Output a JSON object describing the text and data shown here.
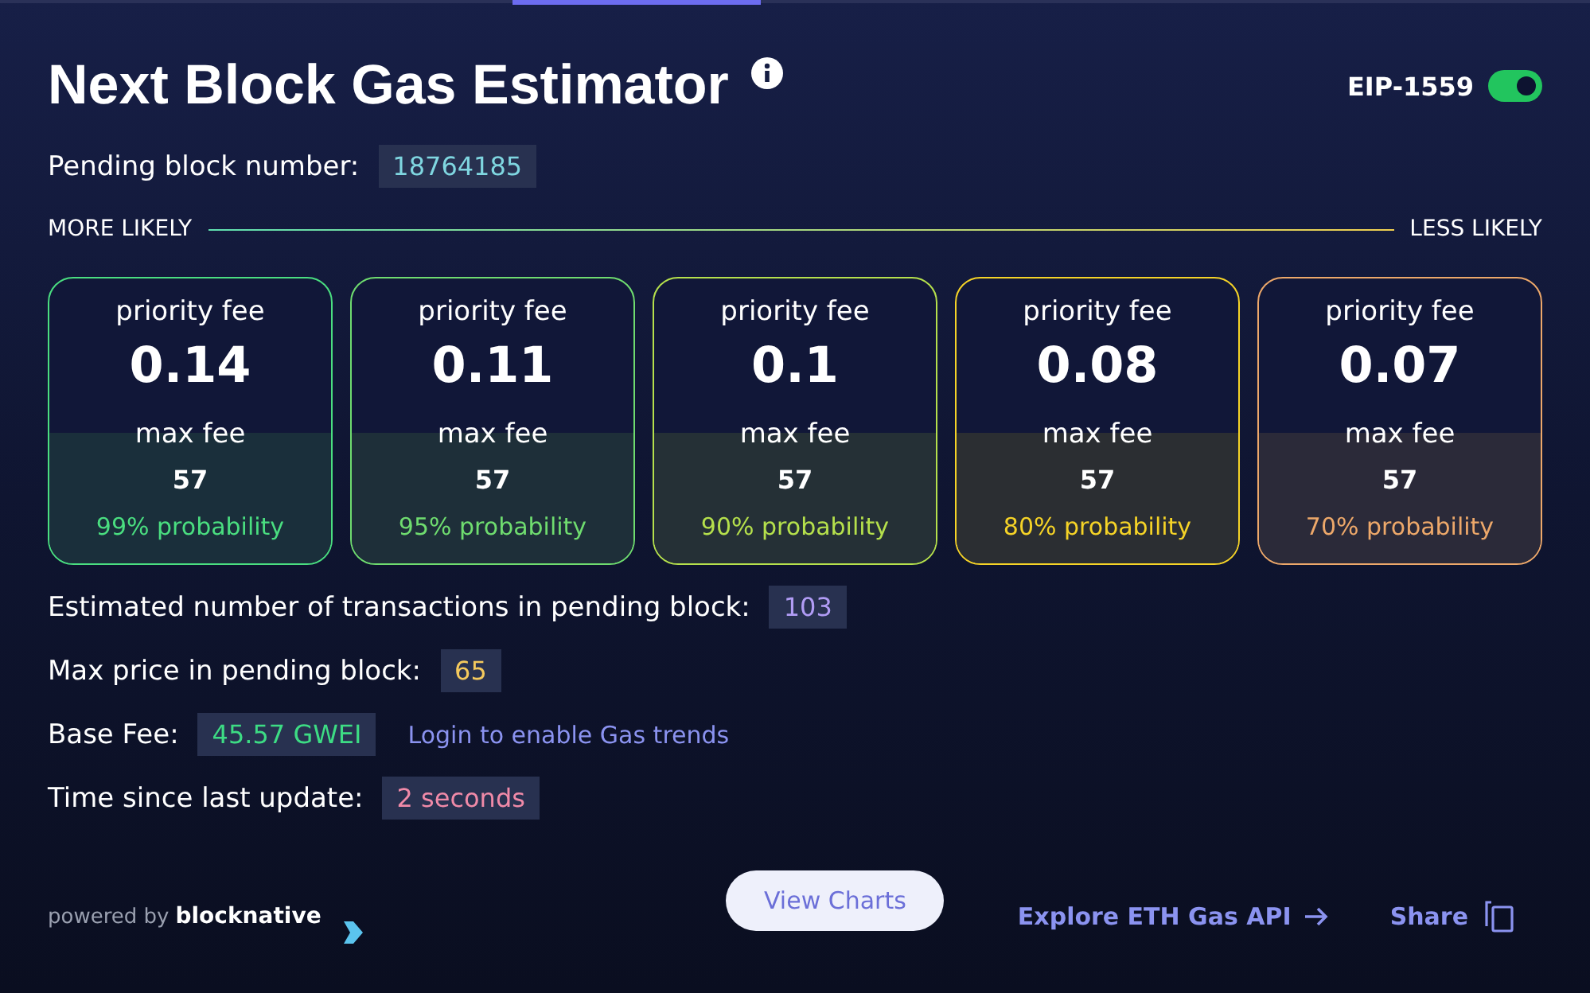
{
  "title": "Next Block Gas Estimator",
  "eip_toggle": {
    "label": "EIP-1559",
    "on": true
  },
  "pending_block": {
    "label": "Pending block number:",
    "value": "18764185"
  },
  "likelihood": {
    "start": "MORE LIKELY",
    "end": "LESS LIKELY"
  },
  "cards": [
    {
      "priority_label": "priority fee",
      "priority": "0.14",
      "max_label": "max fee",
      "max": "57",
      "probability": "99% probability",
      "color": "#4ade80"
    },
    {
      "priority_label": "priority fee",
      "priority": "0.11",
      "max_label": "max fee",
      "max": "57",
      "probability": "95% probability",
      "color": "#6fdc6f"
    },
    {
      "priority_label": "priority fee",
      "priority": "0.1",
      "max_label": "max fee",
      "max": "57",
      "probability": "90% probability",
      "color": "#b5e04c"
    },
    {
      "priority_label": "priority fee",
      "priority": "0.08",
      "max_label": "max fee",
      "max": "57",
      "probability": "80% probability",
      "color": "#f5d327"
    },
    {
      "priority_label": "priority fee",
      "priority": "0.07",
      "max_label": "max fee",
      "max": "57",
      "probability": "70% probability",
      "color": "#eda86a"
    }
  ],
  "stats": [
    {
      "label": "Estimated number of transactions in pending block:",
      "value": "103"
    },
    {
      "label": "Max price in pending block:",
      "value": "65"
    },
    {
      "label": "Base Fee:",
      "value": "45.57 GWEI",
      "link": "Login to enable Gas trends"
    },
    {
      "label": "Time since last update:",
      "value": "2 seconds"
    }
  ],
  "footer": {
    "powered_by": "powered by",
    "brand": "blocknative",
    "button": "View Charts",
    "api_link": "Explore ETH Gas API",
    "share": "Share"
  }
}
